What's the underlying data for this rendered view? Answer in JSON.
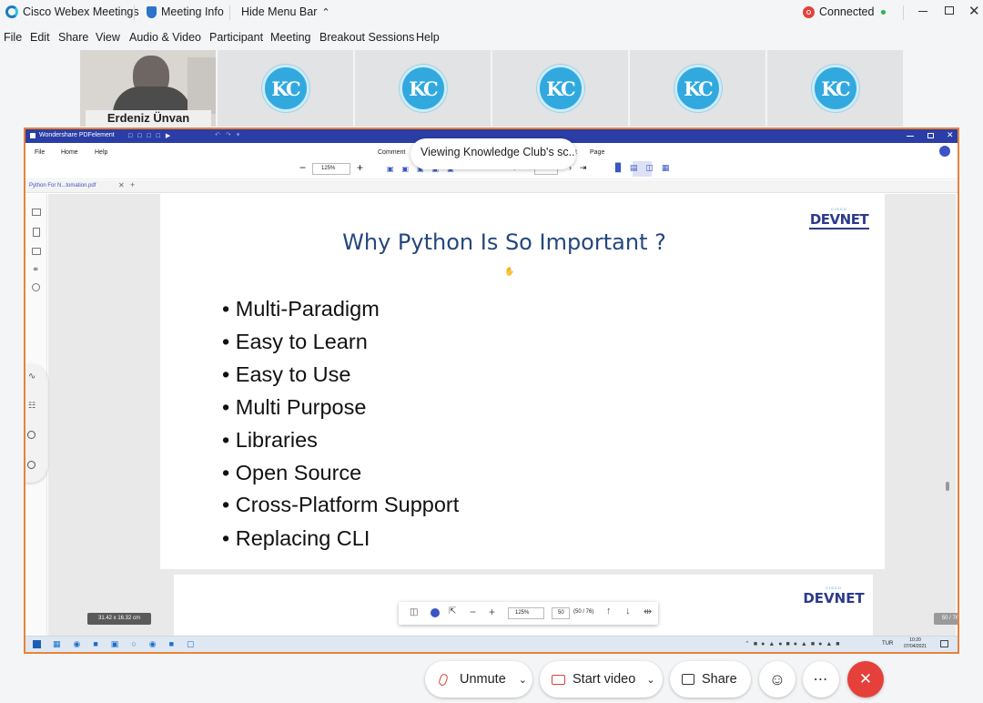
{
  "window": {
    "app_title": "Cisco Webex Meetings",
    "meeting_info": "Meeting Info",
    "hide_menu_bar": "Hide Menu Bar",
    "status": "Connected",
    "status_color": "#e5403a"
  },
  "menu": [
    "File",
    "Edit",
    "Share",
    "View",
    "Audio & Video",
    "Participant",
    "Meeting",
    "Breakout Sessions",
    "Help"
  ],
  "participants": {
    "speaker_name": "Erdeniz Ünvan",
    "logo_text": "KC"
  },
  "share": {
    "viewing_label": "Viewing Knowledge Club's sc...",
    "pdf_app_title": "Wondershare PDFelement",
    "pdf_menu": [
      "File",
      "Home",
      "Help"
    ],
    "pdf_menu_right": [
      "Comment",
      "t",
      "Page"
    ],
    "zoom": "125%",
    "page_input": "50",
    "page_total": "/76",
    "tab_label": "Python For N...tomation.pdf",
    "slide_title": "Why Python Is So Important ?",
    "bullets": [
      "Multi-Paradigm",
      "Easy to Learn",
      "Easy to Use",
      "Multi Purpose",
      "Libraries",
      "Open Source",
      "Cross-Platform Support",
      "Replacing CLI"
    ],
    "devnet_label": "DEVNET",
    "cisco_label": "CISCO",
    "dimensions": "31.42 x 16.32 cm",
    "page_indicator": "50 / 76",
    "toolbar_zoom": "125%",
    "toolbar_page": "50",
    "toolbar_total": "(50 / 76)",
    "clock_time": "10:20",
    "clock_date": "07/04/2021",
    "lang": "TUR"
  },
  "controls": {
    "unmute": "Unmute",
    "start_video": "Start video",
    "share": "Share",
    "end_color": "#e5403a"
  }
}
